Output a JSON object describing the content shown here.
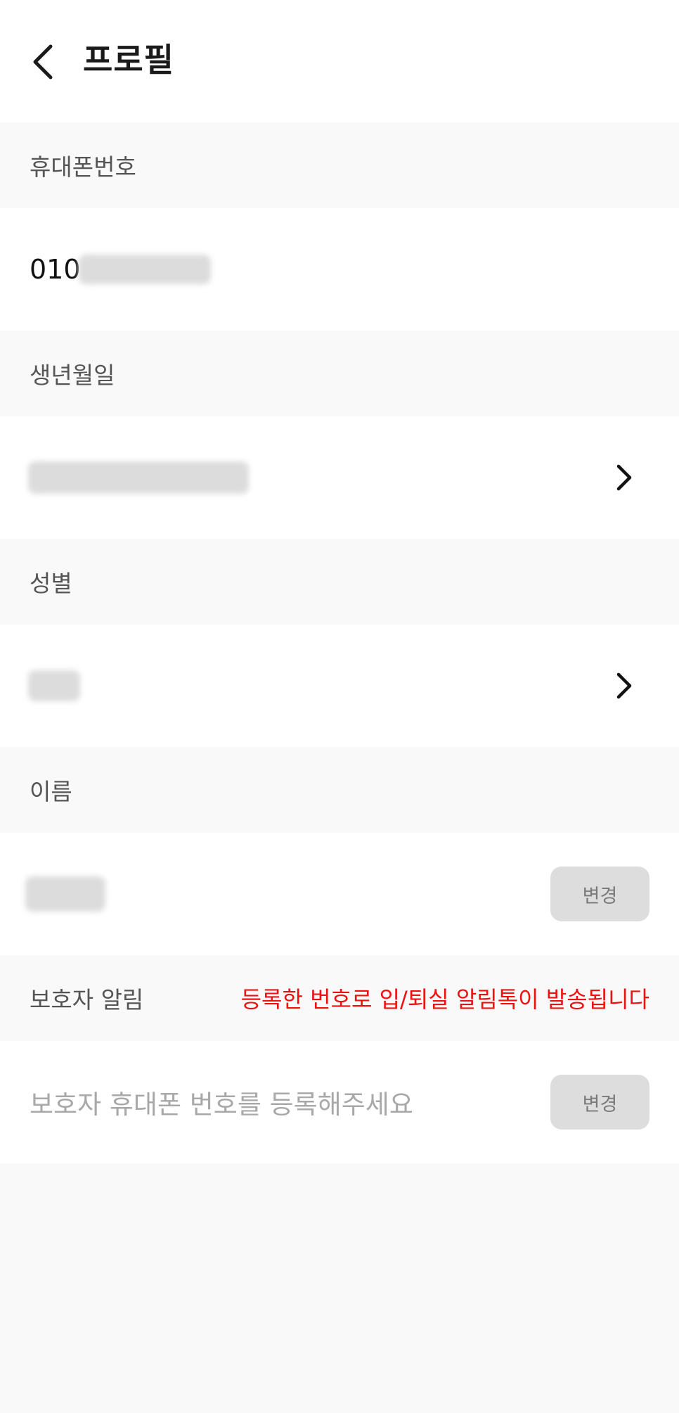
{
  "header": {
    "title": "프로필",
    "back_icon": "chevron-left-icon"
  },
  "phone": {
    "label": "휴대폰번호",
    "value_prefix": "010"
  },
  "birth": {
    "label": "생년월일",
    "chevron_icon": "chevron-right-icon"
  },
  "gender": {
    "label": "성별",
    "chevron_icon": "chevron-right-icon"
  },
  "name": {
    "label": "이름",
    "change_label": "변경"
  },
  "guardian": {
    "label": "보호자 알림",
    "notice": "등록한 번호로 입/퇴실 알림톡이 발송됩니다",
    "placeholder": "보호자 휴대폰 번호를 등록해주세요",
    "change_label": "변경"
  },
  "colors": {
    "notice": "#ee1111",
    "section_bg": "#f9f9f9",
    "row_bg": "#ffffff",
    "button_bg": "#dddddd"
  }
}
